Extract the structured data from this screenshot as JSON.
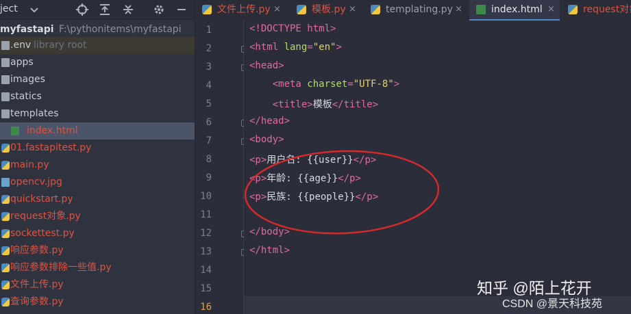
{
  "project_panel": {
    "title": "ject",
    "root": {
      "name": "myfastapi",
      "path": "F:\\pythonitems\\myfastapi"
    },
    "items": [
      {
        "label": ".env",
        "hint": "library root",
        "icon": "folder-icon"
      },
      {
        "label": "apps",
        "icon": "folder-icon"
      },
      {
        "label": "images",
        "icon": "folder-icon"
      },
      {
        "label": "statics",
        "icon": "folder-icon"
      },
      {
        "label": "templates",
        "icon": "folder-icon"
      },
      {
        "label": "index.html",
        "icon": "html-file-icon"
      },
      {
        "label": "01.fastapitest.py",
        "icon": "python-file-icon"
      },
      {
        "label": "main.py",
        "icon": "python-file-icon"
      },
      {
        "label": "opencv.jpg",
        "icon": "image-file-icon"
      },
      {
        "label": "quickstart.py",
        "icon": "python-file-icon"
      },
      {
        "label": "request对象.py",
        "icon": "python-file-icon"
      },
      {
        "label": "sockettest.py",
        "icon": "python-file-icon"
      },
      {
        "label": "响应参数.py",
        "icon": "python-file-icon"
      },
      {
        "label": "响应参数排除一些值.py",
        "icon": "python-file-icon"
      },
      {
        "label": "文件上传.py",
        "icon": "python-file-icon"
      },
      {
        "label": "查询参数.py",
        "icon": "python-file-icon"
      }
    ],
    "selected_index": 5
  },
  "tabs": [
    {
      "label": "文件上传.py",
      "close": "×"
    },
    {
      "label": "模板.py",
      "close": "×"
    },
    {
      "label": "templating.py",
      "close": "×"
    },
    {
      "label": "index.html",
      "close": "×"
    },
    {
      "label": "request对象.py",
      "close": ""
    }
  ],
  "active_tab": 3,
  "editor": {
    "line_numbers": [
      "1",
      "2",
      "3",
      "4",
      "5",
      "6",
      "7",
      "8",
      "9",
      "10",
      "11",
      "12",
      "13",
      "14",
      "15",
      "16"
    ],
    "current_line": "16"
  },
  "watermarks": {
    "zhihu": "知乎 @陌上花开",
    "csdn": "CSDN @景天科技苑"
  },
  "colors": {
    "annotation": "#d62a2a",
    "accent": "#4a88c7",
    "modified_file": "#e0523f"
  }
}
